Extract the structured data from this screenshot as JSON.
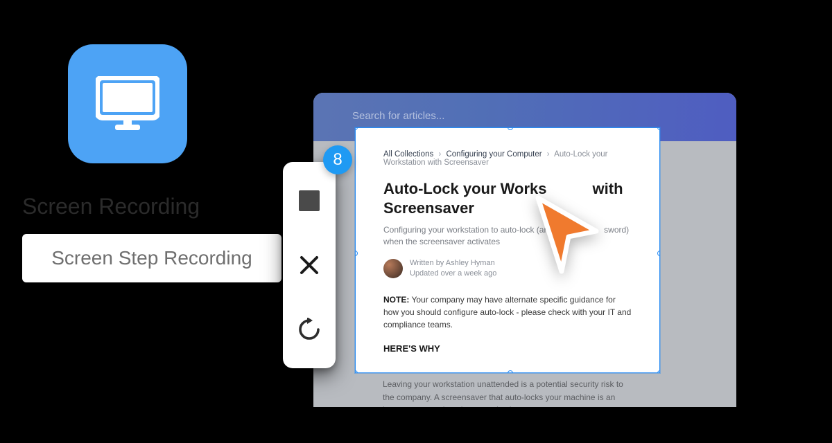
{
  "app": {
    "icon_name": "monitor-icon"
  },
  "options": {
    "screen_recording": "Screen Recording",
    "step_recording": "Screen Step Recording"
  },
  "recorder": {
    "counter": "8"
  },
  "browser": {
    "search_placeholder": "Search for articles..."
  },
  "article": {
    "breadcrumb": {
      "root": "All Collections",
      "section": "Configuring your Computer",
      "current": "Auto-Lock your Workstation with Screensaver"
    },
    "title_part_1": "Auto-Lock your Works",
    "title_part_2": " with Screensaver",
    "subtitle_part_1": "Configuring your workstation to auto-lock (and re",
    "subtitle_part_2": "sword) when the screensaver activates",
    "author": {
      "written_by_label": "Written by ",
      "name": "Ashley Hyman",
      "updated": "Updated over a week ago"
    },
    "note_label": "NOTE:",
    "note_body": " Your company may have alternate specific guidance for how you should configure auto-lock - please check with your IT and compliance teams.",
    "section_head": "HERE'S WHY",
    "body": "Leaving your workstation unattended is a potential security risk to the company. A screensaver that auto-locks your machine is an important control against security threats."
  },
  "colors": {
    "accent_blue": "#1f9af3",
    "icon_blue": "#4DA3F5",
    "cursor_orange": "#f07a2e"
  }
}
